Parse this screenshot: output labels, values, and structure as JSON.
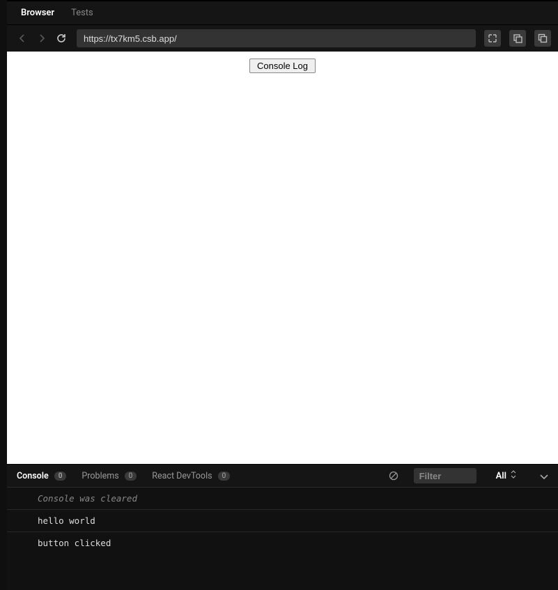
{
  "left_fragment": "",
  "top_tabs": {
    "browser": "Browser",
    "tests": "Tests"
  },
  "url_bar": {
    "value": "https://tx7km5.csb.app/"
  },
  "preview": {
    "button_label": "Console Log"
  },
  "panel": {
    "tabs": {
      "console": {
        "label": "Console",
        "badge": "0"
      },
      "problems": {
        "label": "Problems",
        "badge": "0"
      },
      "react": {
        "label": "React DevTools",
        "badge": "0"
      }
    },
    "filter_placeholder": "Filter",
    "level": "All"
  },
  "console_lines": {
    "0": "Console was cleared",
    "1": "hello world",
    "2": "button clicked"
  }
}
